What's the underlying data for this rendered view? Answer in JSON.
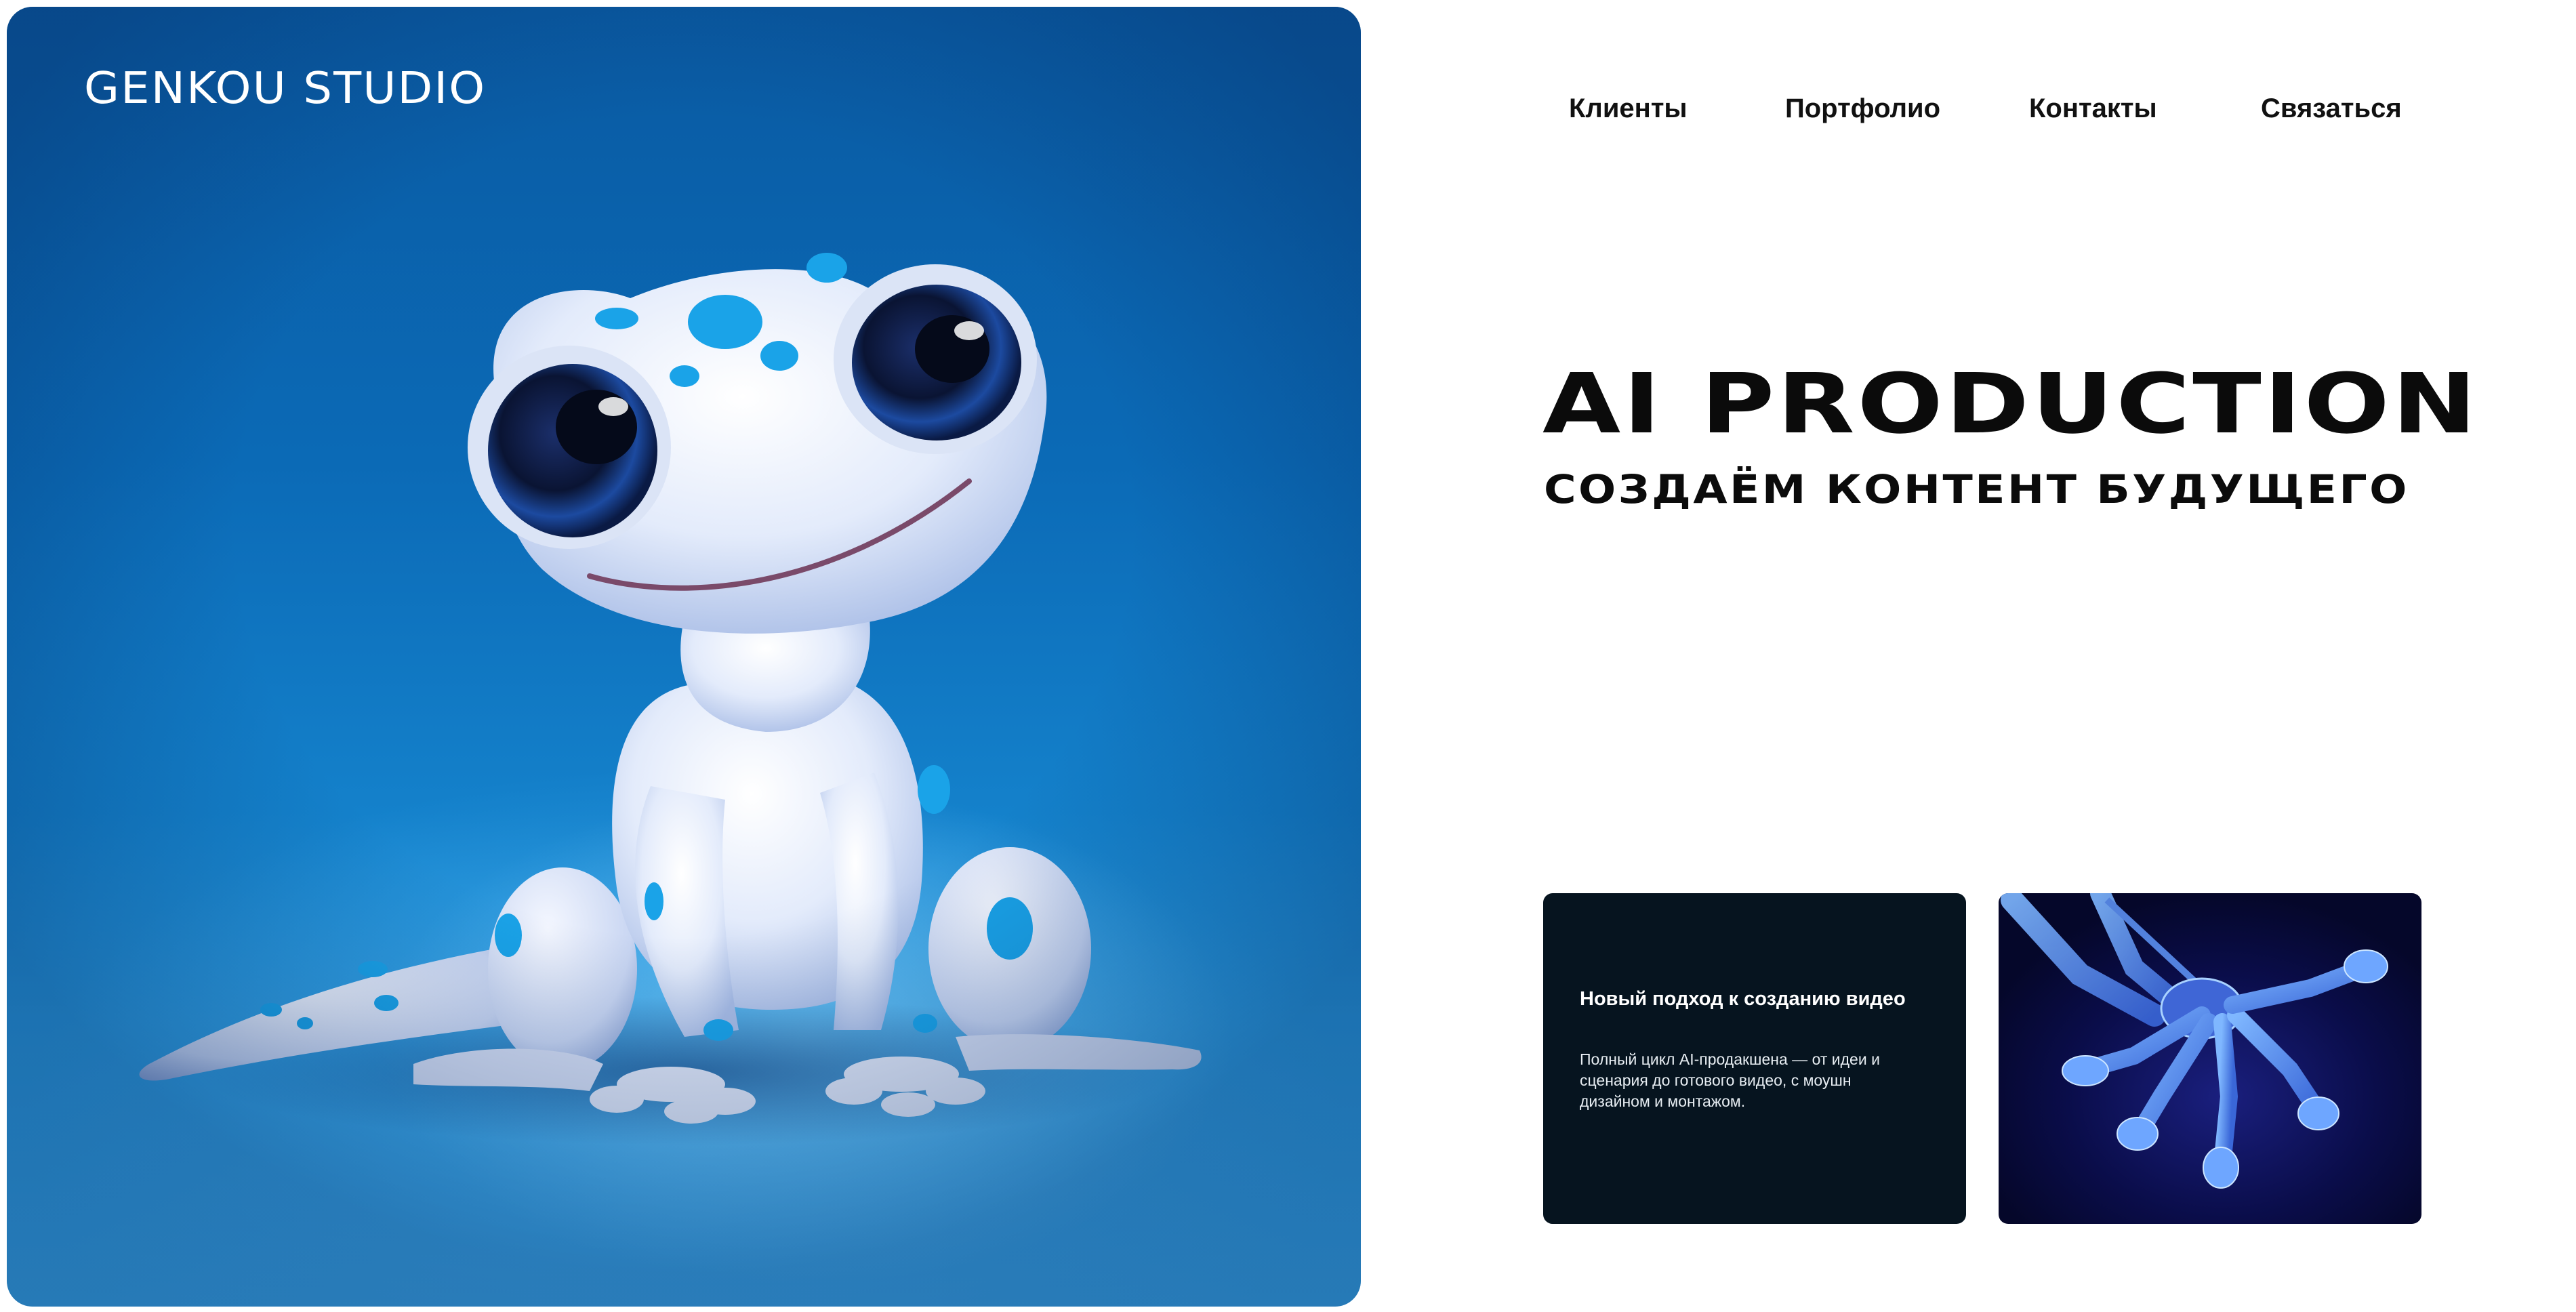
{
  "brand": {
    "logo_text": "GENKOU STUDIO"
  },
  "nav": {
    "items": [
      {
        "label": "Клиенты"
      },
      {
        "label": "Портфолио"
      },
      {
        "label": "Контакты"
      },
      {
        "label": "Связаться"
      }
    ]
  },
  "hero": {
    "title": "AI PRODUCTION",
    "subtitle": "СОЗДАЁМ КОНТЕНТ БУДУЩЕГО",
    "image_subject": "gecko-illustration"
  },
  "cards": {
    "feature": {
      "title": "Новый подход к созданию видео",
      "text": "Полный цикл AI-продакшена — от идеи и сценария до готового видео, с моушн дизайном и монтажом."
    },
    "image": {
      "subject": "gecko-foot-xray"
    }
  },
  "colors": {
    "hero_blue": "#0b6ab6",
    "card_dark": "#06141f",
    "text_dark": "#0b0b0b",
    "gecko_spot": "#1aa3e8"
  }
}
